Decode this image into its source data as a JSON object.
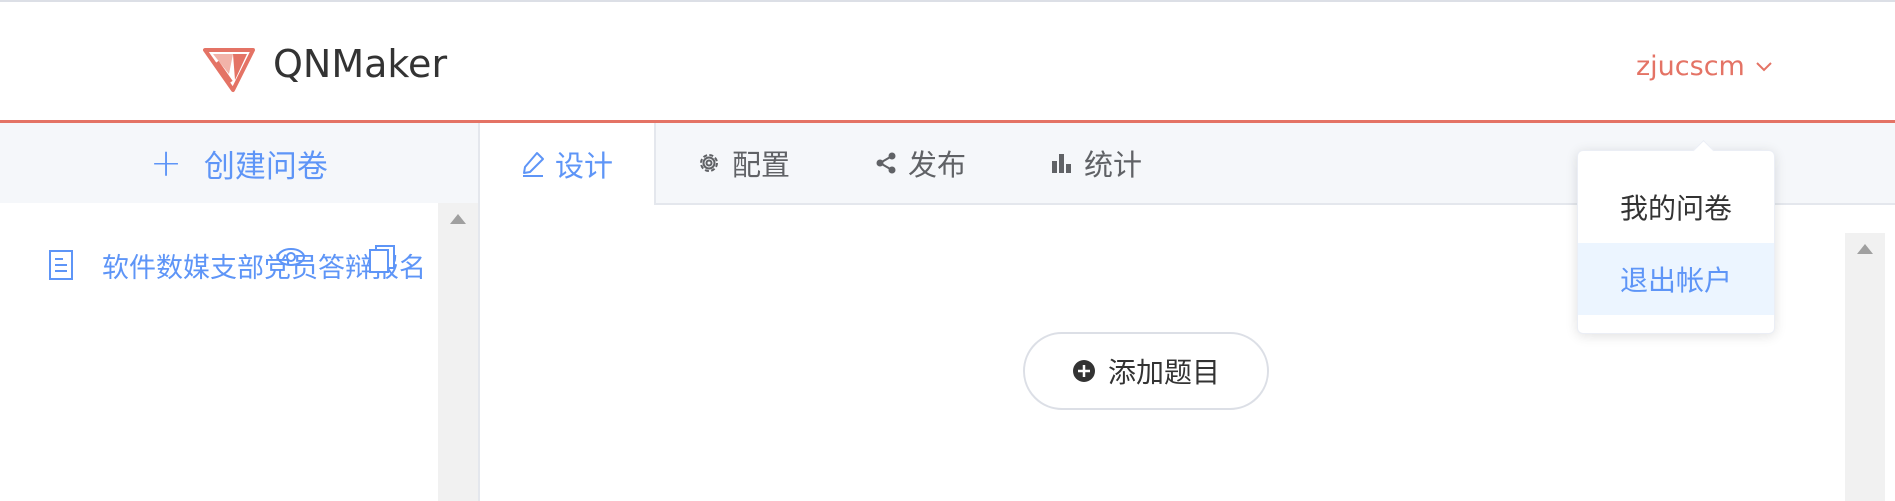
{
  "header": {
    "app_title": "QNMaker",
    "user_name": "zjucscm",
    "logo_icon": "qnmaker-logo-icon",
    "accent_color": "#e47365"
  },
  "sidebar": {
    "create_label": "创建问卷",
    "survey_items": [
      {
        "title": "软件数媒支部党员答辩报名"
      }
    ],
    "primary_color": "#5e95f7"
  },
  "tabs": [
    {
      "label": "设计",
      "icon": "pencil-icon",
      "active": true
    },
    {
      "label": "配置",
      "icon": "gear-icon",
      "active": false
    },
    {
      "label": "发布",
      "icon": "share-icon",
      "active": false
    },
    {
      "label": "统计",
      "icon": "bar-chart-icon",
      "active": false
    }
  ],
  "main": {
    "add_question_label": "添加题目"
  },
  "user_menu": {
    "items": [
      {
        "label": "我的问卷"
      },
      {
        "label": "退出帐户"
      }
    ]
  }
}
